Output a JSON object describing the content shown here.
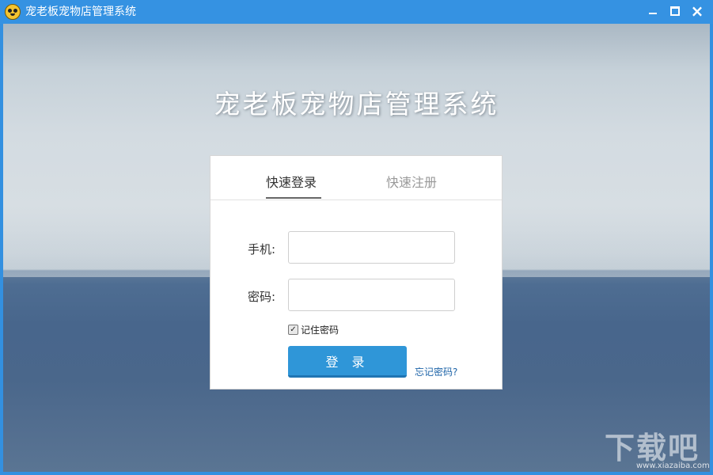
{
  "window": {
    "title": "宠老板宠物店管理系统",
    "controls": {
      "minimize_icon": "minimize-icon",
      "maximize_icon": "maximize-icon",
      "close_icon": "close-icon"
    }
  },
  "hero": {
    "title": "宠老板宠物店管理系统"
  },
  "login_card": {
    "tabs": [
      {
        "label": "快速登录",
        "active": true
      },
      {
        "label": "快速注册",
        "active": false
      }
    ],
    "phone_label": "手机:",
    "phone_value": "",
    "password_label": "密码:",
    "password_value": "",
    "remember_label": "记住密码",
    "remember_checked": true,
    "login_button": "登 录",
    "forgot_link": "忘记密码?"
  },
  "watermark": {
    "text": "下载吧",
    "sub": "www.xiazaiba.com"
  }
}
